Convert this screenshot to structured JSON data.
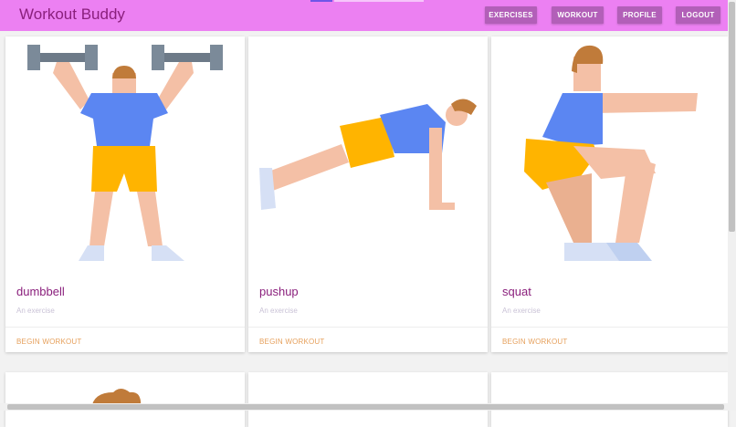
{
  "app": {
    "title": "Workout Buddy"
  },
  "nav": {
    "items": [
      {
        "label": "EXERCISES"
      },
      {
        "label": "WORKOUT"
      },
      {
        "label": "PROFILE"
      },
      {
        "label": "LOGOUT"
      }
    ]
  },
  "cards": [
    {
      "title": "dumbbell",
      "subtitle": "An exercise",
      "action": "BEGIN WORKOUT",
      "illustration": "dumbbell-lift-illustration"
    },
    {
      "title": "pushup",
      "subtitle": "An exercise",
      "action": "BEGIN WORKOUT",
      "illustration": "pushup-illustration"
    },
    {
      "title": "squat",
      "subtitle": "An exercise",
      "action": "BEGIN WORKOUT",
      "illustration": "squat-illustration"
    }
  ],
  "colors": {
    "navbar": "#ec80f2",
    "nav_button": "#b25fb8",
    "brand_text": "#8a1f7c",
    "action_text": "#e6a05c"
  }
}
